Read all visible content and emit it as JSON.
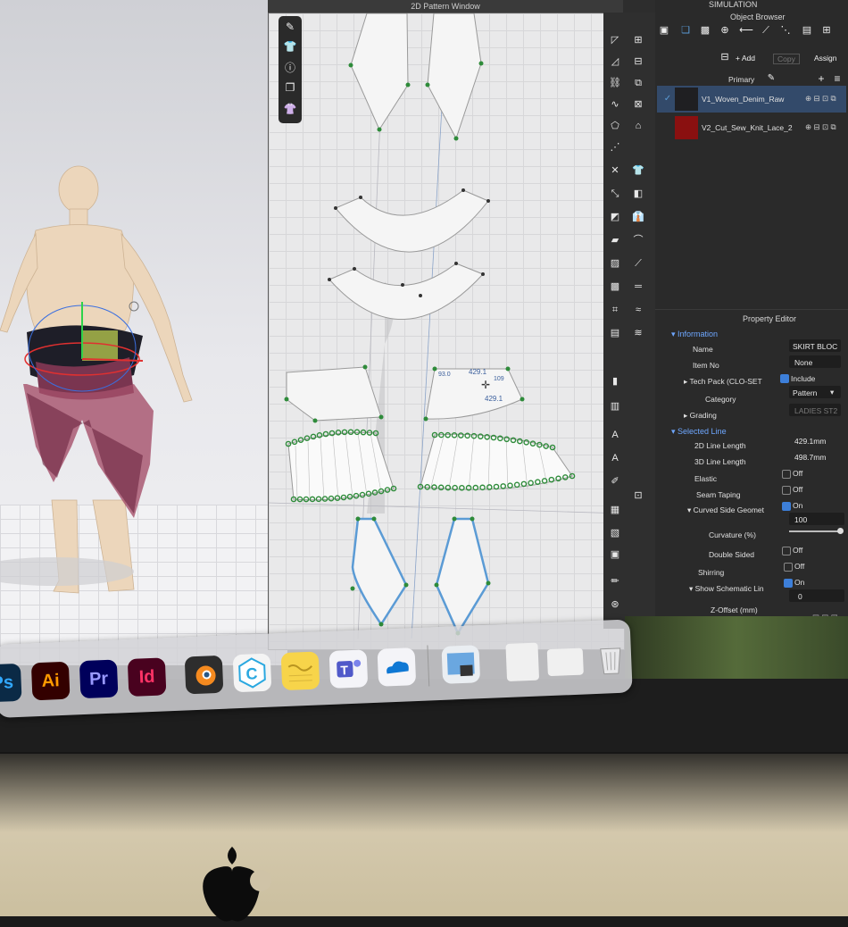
{
  "windows": {
    "pattern_title": "2D Pattern Window",
    "object_browser_title": "Object Browser",
    "property_editor_title": "Property Editor",
    "simulation_label": "SIMULATION"
  },
  "object_browser": {
    "add_label": "+ Add",
    "copy_label": "Copy",
    "assign_label": "Assign",
    "primary_label": "Primary",
    "fabrics": [
      {
        "name": "V1_Woven_Denim_Raw",
        "selected": true
      },
      {
        "name": "V2_Cut_Sew_Knit_Lace_2",
        "selected": false
      }
    ]
  },
  "property_editor": {
    "information_label": "Information",
    "name_label": "Name",
    "name_value": "SKIRT BLOC",
    "item_no_label": "Item No",
    "item_no_value": "None",
    "tech_pack_label": "Tech Pack (CLO-SET",
    "include_label": "Include",
    "category_label": "Category",
    "category_value": "Pattern",
    "grading_label": "Grading",
    "grading_value": "LADIES ST2",
    "selected_line_label": "Selected Line",
    "line_2d_label": "2D Line Length",
    "line_2d_value": "429.1mm",
    "line_3d_label": "3D Line Length",
    "line_3d_value": "498.7mm",
    "elastic_label": "Elastic",
    "elastic_value": "Off",
    "seam_taping_label": "Seam Taping",
    "seam_taping_value": "Off",
    "curved_label": "Curved Side Geomet",
    "curved_value": "On",
    "curvature_label": "Curvature (%)",
    "curvature_value": "100",
    "double_sided_label": "Double Sided",
    "double_sided_value": "Off",
    "shirring_label": "Shirring",
    "shirring_value": "Off",
    "schematic_label": "Show Schematic Lin",
    "schematic_value": "On",
    "zoffset_label": "Z-Offset (mm)",
    "zoffset_value": "0"
  },
  "measure": {
    "a": "429.1",
    "b": "429.1",
    "c": "109",
    "d": "93.0"
  },
  "dock": {
    "apps": [
      {
        "label": "Ps",
        "bg": "#0b2a46",
        "fg": "#31a8ff"
      },
      {
        "label": "Ai",
        "bg": "#330000",
        "fg": "#ff9a00"
      },
      {
        "label": "Pr",
        "bg": "#00005b",
        "fg": "#9999ff"
      },
      {
        "label": "Id",
        "bg": "#49021f",
        "fg": "#ff3366"
      }
    ]
  },
  "colors": {
    "accent": "#3d7fd9",
    "pattern_point": "#2e8b3a",
    "selection_outline": "#5b9bd5"
  }
}
